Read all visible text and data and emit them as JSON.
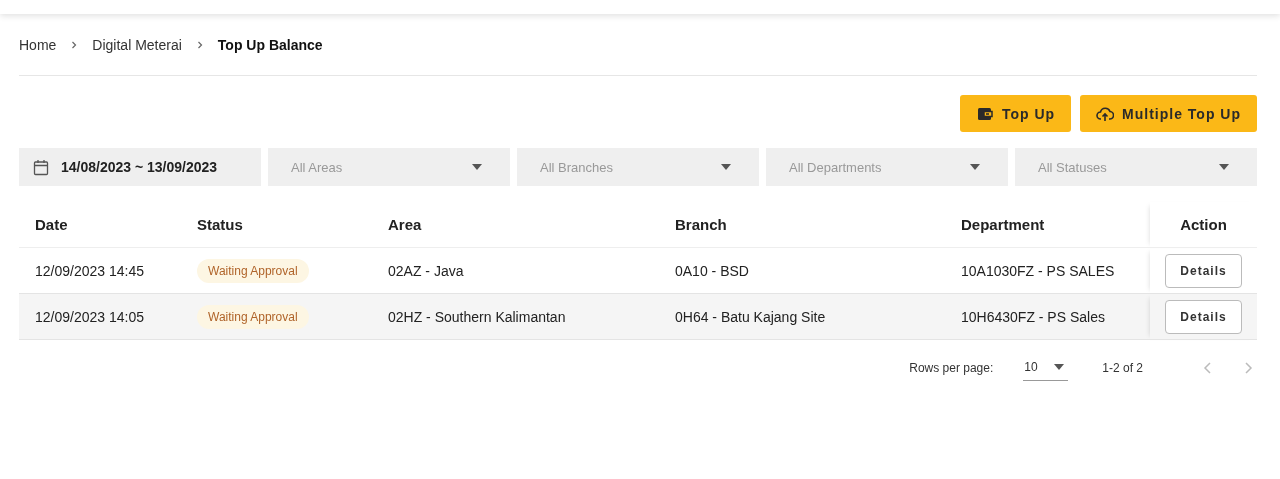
{
  "breadcrumb": [
    {
      "label": "Home",
      "current": false
    },
    {
      "label": "Digital Meterai",
      "current": false
    },
    {
      "label": "Top Up Balance",
      "current": true
    }
  ],
  "actions": [
    {
      "label": "Top Up",
      "kind": "wallet"
    },
    {
      "label": "Multiple Top Up",
      "kind": "upload"
    }
  ],
  "filters": {
    "date_range": "14/08/2023 ~ 13/09/2023",
    "selects": [
      {
        "placeholder": "All Areas"
      },
      {
        "placeholder": "All Branches"
      },
      {
        "placeholder": "All Departments"
      },
      {
        "placeholder": "All Statuses"
      }
    ]
  },
  "table": {
    "columns": [
      "Date",
      "Status",
      "Area",
      "Branch",
      "Department",
      "Action"
    ],
    "rows": [
      {
        "date": "12/09/2023 14:45",
        "status": "Waiting Approval",
        "area": "02AZ - Java",
        "branch": "0A10 - BSD",
        "department": "10A1030FZ - PS SALES",
        "action": "Details"
      },
      {
        "date": "12/09/2023 14:05",
        "status": "Waiting Approval",
        "area": "02HZ - Southern Kalimantan",
        "branch": "0H64 - Batu Kajang Site",
        "department": "10H6430FZ - PS Sales",
        "action": "Details"
      }
    ]
  },
  "pagination": {
    "rows_per_page_label": "Rows per page:",
    "rows_per_page": "10",
    "range": "1-2 of 2",
    "prev_disabled": true,
    "next_disabled": true
  }
}
